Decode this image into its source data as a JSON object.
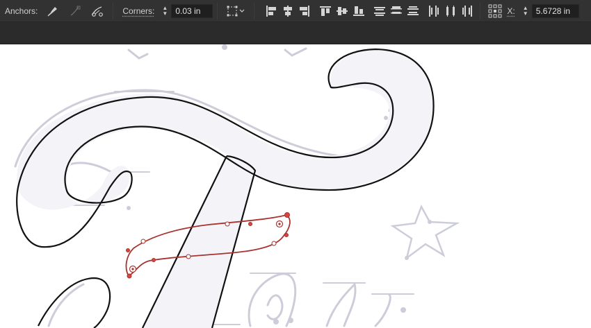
{
  "control_bar": {
    "anchors_label": "Anchors:",
    "corners_label": "Corners:",
    "corners_value": "0.03 in",
    "x_label": "X:",
    "x_value": "5.6728 in"
  },
  "icons": {
    "convert_anchor": "pen-anchor-icon",
    "remove_anchor": "remove-anchor-icon",
    "cut_path": "scissors-icon",
    "transform": "transform-grid-icon",
    "align_left": "align-left-icon",
    "align_hcenter": "align-horizontal-center-icon",
    "align_right": "align-right-icon",
    "align_top": "align-top-icon",
    "align_vcenter": "align-vertical-center-icon",
    "align_bottom": "align-bottom-icon",
    "reference_point": "reference-point-icon"
  },
  "colors": {
    "toolbar_bg": "#323232",
    "tabstrip_bg": "#2b2b2b",
    "selection_path": "#a8322f",
    "outline": "#111111",
    "sketch": "#c9c9d6"
  }
}
